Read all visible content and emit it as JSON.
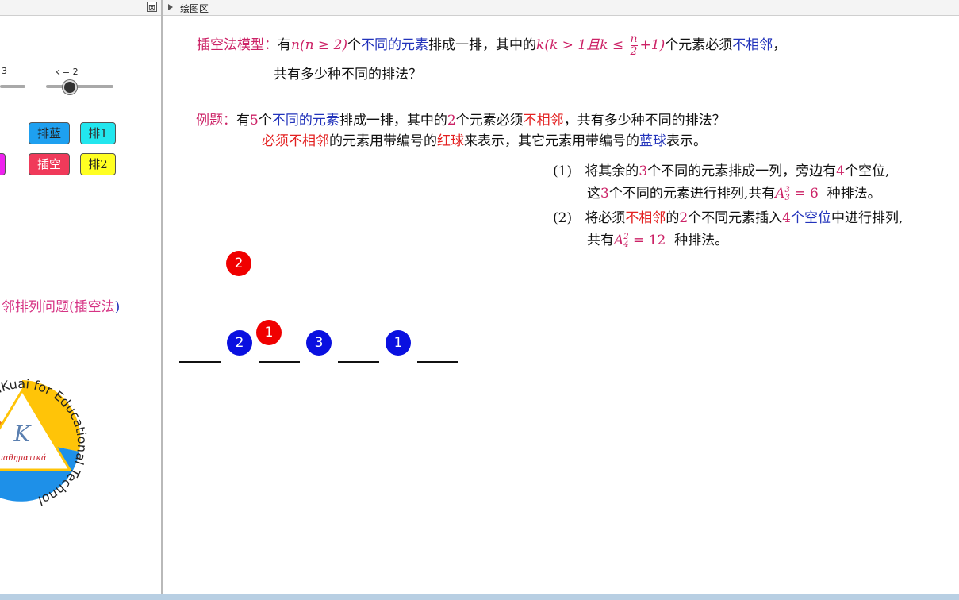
{
  "left_panel": {
    "close_symbol": "⊠",
    "slider_n_label": "3",
    "slider_k_label": "k = 2",
    "buttons": {
      "pai_lan": "排蓝",
      "pai_1": "排1",
      "cha_kong": "插空",
      "pai_2": "排2"
    },
    "caption_part1": "邻排列问题(",
    "caption_part2": "插空法",
    "caption_part3": ")",
    "logo": {
      "ring_text": "ter of QinKuai for Educational Technol",
      "center_glyph": "K",
      "center_word": "μαθηματικά"
    },
    "colors": {
      "btn_blue": "#1ea0f0",
      "btn_cyan": "#22e6ee",
      "btn_red": "#f03a5a",
      "btn_yellow": "#ffff22",
      "btn_magenta": "#ee22ee"
    }
  },
  "graphics": {
    "title": "绘图区",
    "model": {
      "label": "插空法模型：",
      "s1": "有",
      "m1": "n(n ≥ 2)",
      "s2": "个",
      "s3": "不同的元素",
      "s4": "排成一排，其中的",
      "m2": "k(k > 1且k ≤",
      "frac_num": "n",
      "frac_den": "2",
      "m3": "+1)",
      "s5": "个元素必须",
      "s6": "不相邻",
      "s7": "，",
      "line2": "共有多少种不同的排法？"
    },
    "example": {
      "label": "例题：",
      "s1": "有",
      "n5": "5",
      "s2": "个",
      "s3": "不同的元素",
      "s4": "排成一排，其中的",
      "n2": "2",
      "s5": "个元素必须",
      "s6": "不相邻",
      "s7": "，共有多少种不同的排法？",
      "l2a": "必须不相邻",
      "l2b": "的元素用带编号的",
      "l2c": "红球",
      "l2d": "来表示，其它元素用带编号的",
      "l2e": "蓝球",
      "l2f": "表示。"
    },
    "steps": {
      "s1_num": "(1)",
      "s1_a": "将其余的",
      "s1_n3": "3",
      "s1_b": "个不同的元素排成一列，旁边有",
      "s1_n4": "4",
      "s1_c": "个空位,",
      "s1_l2a": "这",
      "s1_l2n": "3",
      "s1_l2b": "个不同的元素进行排列,共有",
      "s1_formula": "A",
      "s1_sup": "3",
      "s1_sub": "3",
      "s1_eq": " = 6",
      "s1_l2c": "种排法。",
      "s2_num": "(2)",
      "s2_a": "将必须",
      "s2_b": "不相邻",
      "s2_c": "的",
      "s2_n2": "2",
      "s2_d": "个不同元素插入",
      "s2_n4": "4",
      "s2_e": "个空位",
      "s2_f": "中进行排列,",
      "s2_l2a": "共有",
      "s2_formula": "A",
      "s2_sup": "2",
      "s2_sub": "4",
      "s2_eq": " = 12",
      "s2_l2b": "种排法。"
    },
    "balls": [
      {
        "label": "2",
        "color": "red"
      },
      {
        "label": "1",
        "color": "red"
      },
      {
        "label": "2",
        "color": "blue"
      },
      {
        "label": "3",
        "color": "blue"
      },
      {
        "label": "1",
        "color": "blue"
      }
    ]
  }
}
